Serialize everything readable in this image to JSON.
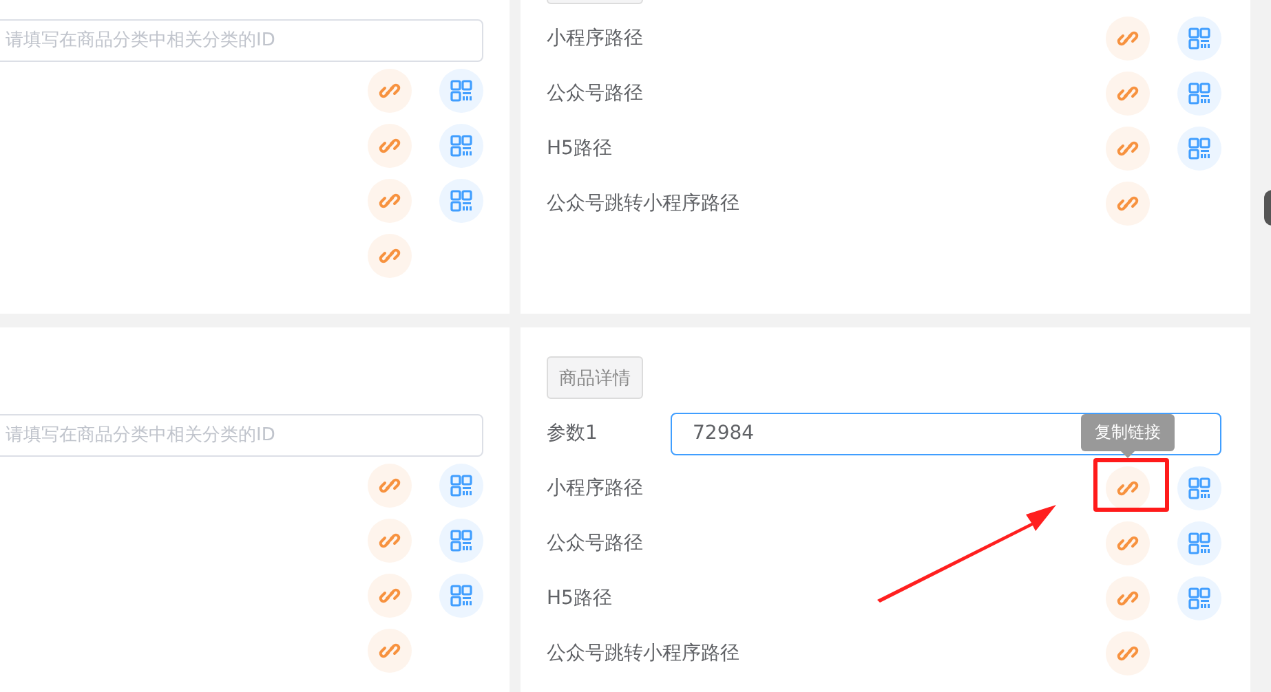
{
  "top_left": {
    "input": {
      "placeholder": "请填写在商品分类中相关分类的ID"
    },
    "rows": [
      {
        "has_qr": true
      },
      {
        "has_qr": true
      },
      {
        "has_qr": true
      },
      {
        "has_qr": false
      }
    ]
  },
  "top_right": {
    "button_cut": true,
    "rows": [
      {
        "label": "小程序路径",
        "has_qr": true,
        "highlighted": false
      },
      {
        "label": "公众号路径",
        "has_qr": true,
        "highlighted": false
      },
      {
        "label": "H5路径",
        "has_qr": true,
        "highlighted": false
      },
      {
        "label": "公众号跳转小程序路径",
        "has_qr": false,
        "highlighted": false
      }
    ]
  },
  "bottom_left": {
    "input": {
      "placeholder": "请填写在商品分类中相关分类的ID"
    },
    "rows": [
      {
        "has_qr": true
      },
      {
        "has_qr": true
      },
      {
        "has_qr": true
      },
      {
        "has_qr": false
      }
    ]
  },
  "bottom_right": {
    "button": "商品详情",
    "param": {
      "label": "参数1",
      "value": "72984",
      "focused": true
    },
    "rows": [
      {
        "label": "小程序路径",
        "has_qr": true,
        "highlighted": true,
        "tooltip": "复制链接"
      },
      {
        "label": "公众号路径",
        "has_qr": true,
        "highlighted": false
      },
      {
        "label": "H5路径",
        "has_qr": true,
        "highlighted": false
      },
      {
        "label": "公众号跳转小程序路径",
        "has_qr": false,
        "highlighted": false
      }
    ]
  },
  "annotation": {
    "arrow": true
  }
}
